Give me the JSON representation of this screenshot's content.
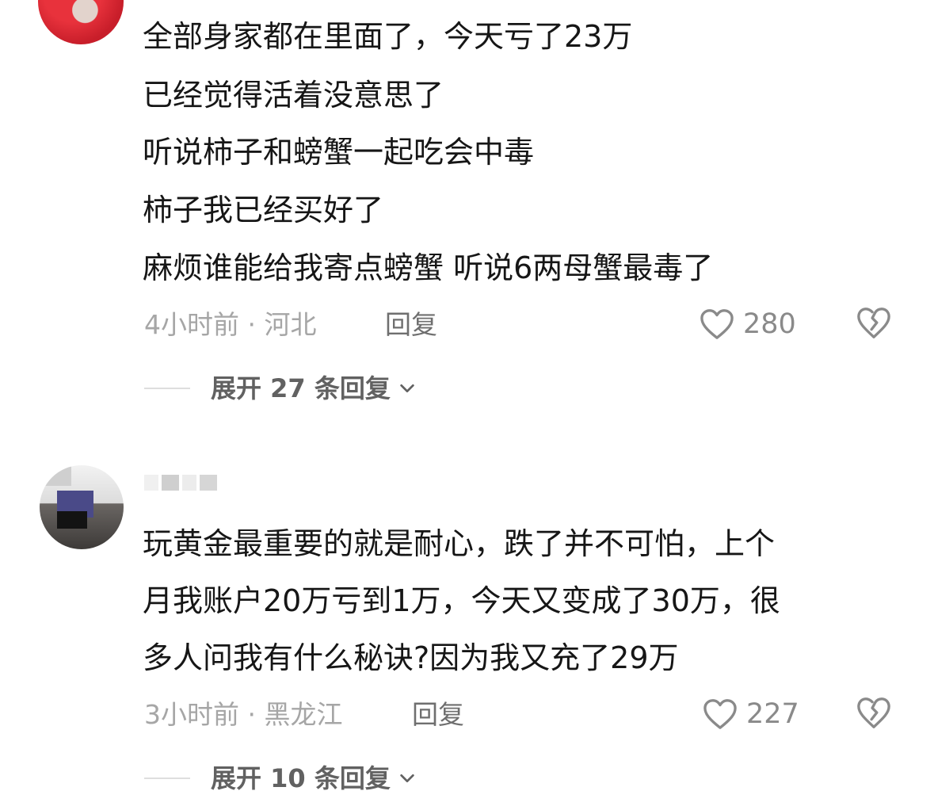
{
  "comments": [
    {
      "lines": [
        "全部身家都在里面了，今天亏了23万",
        "已经觉得活着没意思了",
        "听说柿子和螃蟹一起吃会中毒",
        "柿子我已经买好了",
        "麻烦谁能给我寄点螃蟹  听说6两母蟹最毒了"
      ],
      "meta": "4小时前 · 河北",
      "reply_label": "回复",
      "likes": "280",
      "expand_label": "展开 27 条回复"
    },
    {
      "lines": [
        "玩黄金最重要的就是耐心，跌了并不可怕，上个",
        "月我账户20万亏到1万，今天又变成了30万，很",
        "多人问我有什么秘诀?因为我又充了29万"
      ],
      "meta": "3小时前 · 黑龙江",
      "reply_label": "回复",
      "likes": "227",
      "expand_label": "展开 10 条回复"
    }
  ],
  "icons": {
    "like": "heart-outline-icon",
    "dislike": "broken-heart-icon",
    "expand": "chevron-down-icon"
  },
  "colors": {
    "text": "#161616",
    "meta": "#a6a6a6",
    "icon": "#8a8a8a"
  }
}
